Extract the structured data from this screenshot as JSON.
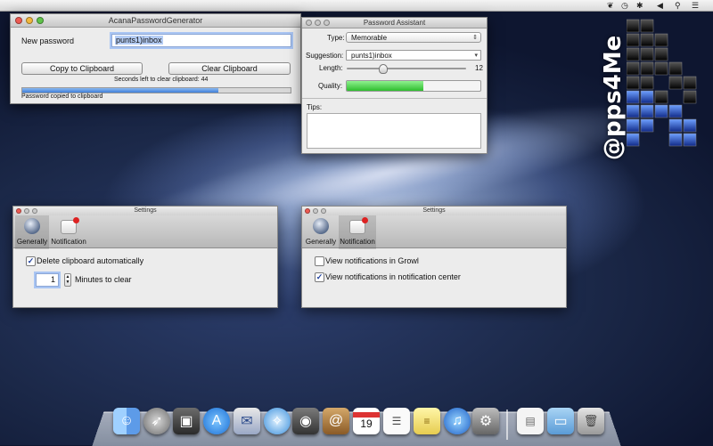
{
  "main_window": {
    "title": "AcanaPasswordGenerator",
    "new_password_label": "New password",
    "new_password_value": "punts1)inbox",
    "copy_button": "Copy to Clipboard",
    "clear_button": "Clear Clipboard",
    "countdown": "Seconds left to clear clipboard: 44",
    "progress_fraction": 0.73,
    "status": "Password copied to clipboard"
  },
  "assistant": {
    "title": "Password Assistant",
    "type_label": "Type:",
    "type_value": "Memorable",
    "suggestion_label": "Suggestion:",
    "suggestion_value": "punts1)inbox",
    "length_label": "Length:",
    "length_value": "12",
    "length_fraction": 0.3,
    "quality_label": "Quality:",
    "quality_fraction": 0.57,
    "tips_label": "Tips:"
  },
  "settings_left": {
    "title": "Settings",
    "tab_general": "Generally",
    "tab_notification": "Notification",
    "delete_label": "Delete clipboard automatically",
    "delete_checked": true,
    "minutes_value": "1",
    "minutes_label": "Minutes to clear"
  },
  "settings_right": {
    "title": "Settings",
    "tab_general": "Generally",
    "tab_notification": "Notification",
    "growl_label": "View notifications in Growl",
    "growl_checked": false,
    "center_label": "View notifications in notification center",
    "center_checked": true
  },
  "watermark": "@pps4Me",
  "dock": {
    "calendar_day": "19",
    "icons": [
      "finder",
      "launchpad",
      "photo-booth",
      "app-store",
      "mail",
      "safari",
      "facetime",
      "contacts",
      "calendar",
      "reminders",
      "notes",
      "itunes",
      "system-preferences",
      "document",
      "folder",
      "trash"
    ]
  },
  "colors": {
    "progress_blue": "#4d8fe0",
    "quality_green": "#3cc93c",
    "selection": "#a9c5f3"
  }
}
